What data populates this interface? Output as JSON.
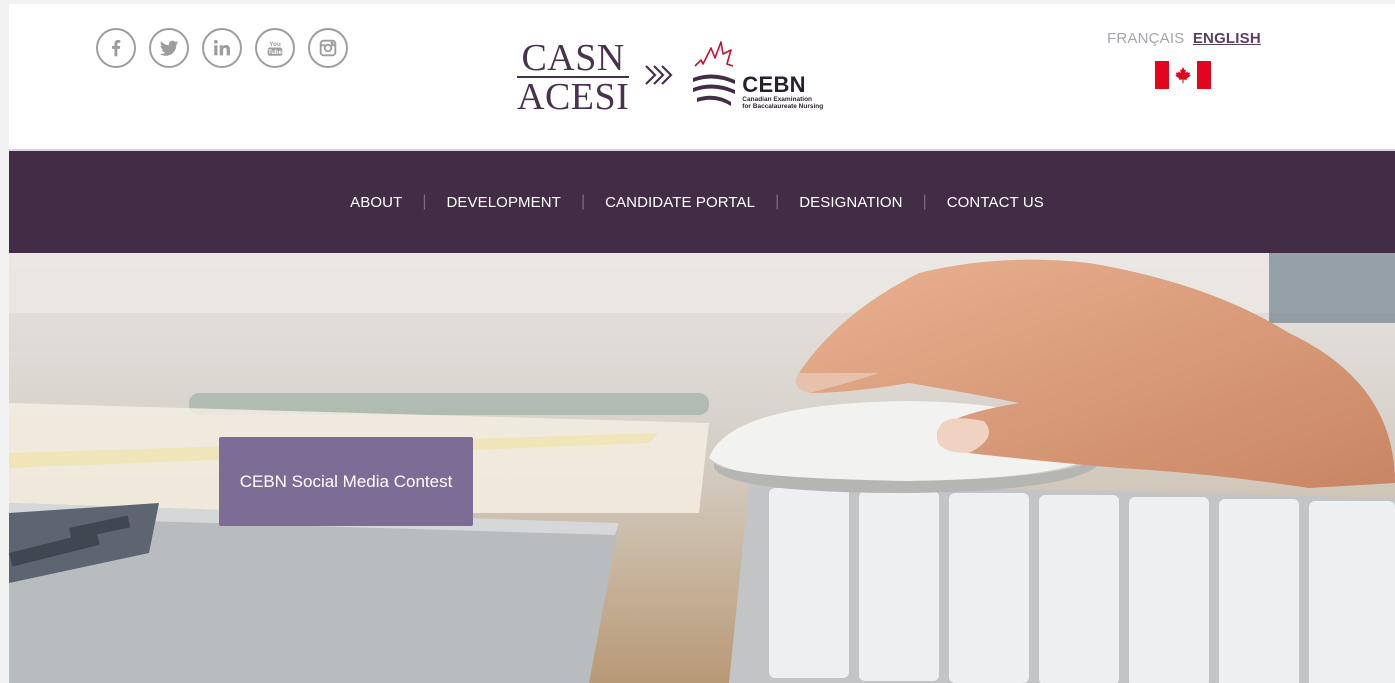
{
  "social": {
    "icons": [
      "facebook-icon",
      "twitter-icon",
      "linkedin-icon",
      "youtube-icon",
      "instagram-icon"
    ]
  },
  "logo": {
    "casn_top": "CASN",
    "casn_bottom": "ACESI",
    "cebn_title": "CEBN",
    "cebn_line1": "Canadian Examination",
    "cebn_line2": "for Baccalaureate Nursing"
  },
  "language": {
    "french_label": "FRANÇAIS",
    "english_label": "ENGLISH",
    "active": "english"
  },
  "nav": {
    "items": [
      {
        "label": "ABOUT"
      },
      {
        "label": "DEVELOPMENT"
      },
      {
        "label": "CANDIDATE PORTAL"
      },
      {
        "label": "DESIGNATION"
      },
      {
        "label": "CONTACT US"
      }
    ],
    "separator": "|"
  },
  "hero": {
    "promo_line": "CEBN Social Media Contest"
  },
  "colors": {
    "brand_purple": "#432d46",
    "promo_purple": "#7d6c96",
    "flag_red": "#e3051b"
  }
}
